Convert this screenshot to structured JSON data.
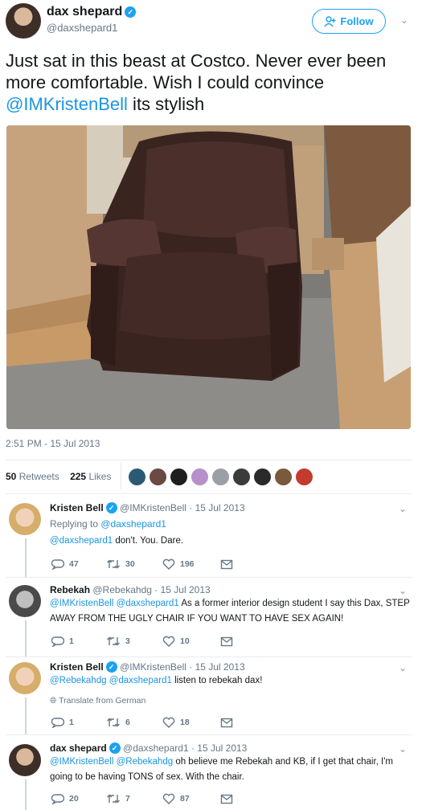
{
  "tweet": {
    "author_name": "dax shepard",
    "author_handle": "@daxshepard1",
    "follow_label": "Follow",
    "text_before": "Just sat in this beast at Costco. Never ever been more comfortable. Wish I could convince ",
    "text_mention": "@IMKristenBell",
    "text_after": " its stylish",
    "timestamp": "2:51 PM - 15 Jul 2013",
    "retweets_count": "50",
    "retweets_label": "Retweets",
    "likes_count": "225",
    "likes_label": "Likes"
  },
  "colors": {
    "accent": "#1da1f2",
    "link": "#1b95e0",
    "muted": "#657786"
  },
  "replies": [
    {
      "name": "Kristen Bell",
      "handle": "@IMKristenBell",
      "date": "· 15 Jul 2013",
      "replying_prefix": "Replying to ",
      "replying_to": "@daxshepard1",
      "mentions": "@daxshepard1",
      "text": " don't. You. Dare.",
      "replies": "47",
      "retweets": "30",
      "likes": "196"
    },
    {
      "name": "Rebekah",
      "handle": "@Rebekahdg",
      "date": "· 15 Jul 2013",
      "mentions": "@IMKristenBell @daxshepard1",
      "text": " As a former interior design student I say this Dax, STEP AWAY FROM THE UGLY CHAIR IF YOU WANT TO HAVE SEX AGAIN!",
      "replies": "1",
      "retweets": "3",
      "likes": "10"
    },
    {
      "name": "Kristen Bell",
      "handle": "@IMKristenBell",
      "date": "· 15 Jul 2013",
      "mentions": "@Rebekahdg @daxshepard1",
      "text": " listen to rebekah dax!",
      "translate": "Translate from German",
      "replies": "1",
      "retweets": "6",
      "likes": "18"
    },
    {
      "name": "dax shepard",
      "handle": "@daxshepard1",
      "date": "· 15 Jul 2013",
      "mentions": "@IMKristenBell @Rebekahdg",
      "text": " oh believe me Rebekah and KB, if I get that chair, I'm going to be having TONS of sex. With the chair.",
      "replies": "20",
      "retweets": "7",
      "likes": "87"
    }
  ]
}
